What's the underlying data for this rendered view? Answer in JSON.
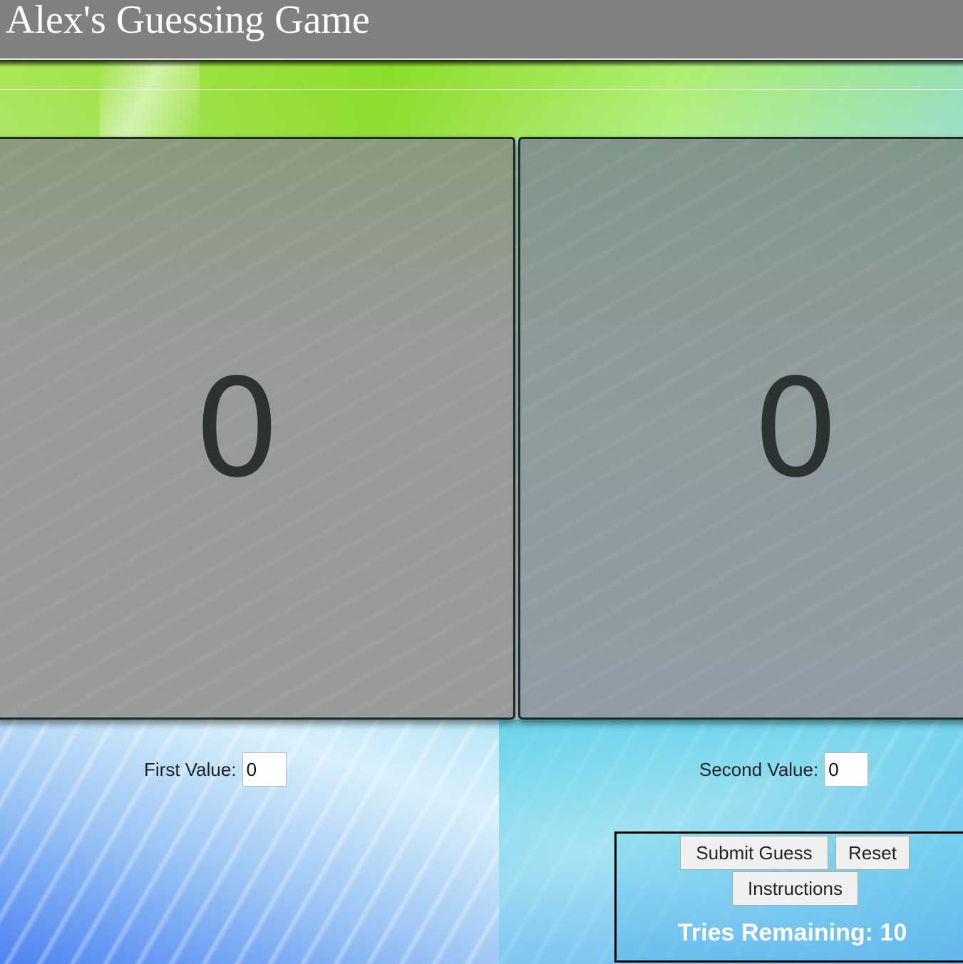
{
  "header": {
    "title": "Alex's Guessing Game"
  },
  "panels": {
    "left_value": "0",
    "right_value": "0"
  },
  "inputs": {
    "first_label": "First Value:",
    "first_value": "0",
    "second_label": "Second Value:",
    "second_value": "0"
  },
  "controls": {
    "submit_label": "Submit Guess",
    "reset_label": "Reset",
    "instructions_label": "Instructions",
    "tries_text": "Tries Remaining: 10"
  },
  "colors": {
    "header_bg": "#808080",
    "panel_bg": "#969696",
    "digit_color": "#2d3330",
    "tries_text": "#ffffff"
  }
}
